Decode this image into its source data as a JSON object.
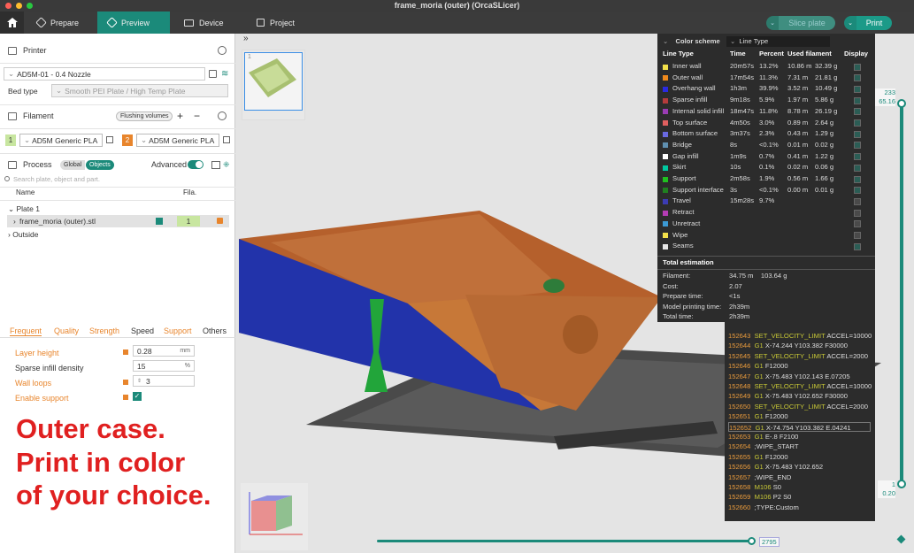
{
  "window": {
    "title": "frame_moria (outer) (OrcaSLicer)"
  },
  "toolbar": {
    "tabs": [
      {
        "label": "Prepare"
      },
      {
        "label": "Preview"
      },
      {
        "label": "Device"
      },
      {
        "label": "Project"
      }
    ],
    "slice_label": "Slice plate",
    "print_label": "Print"
  },
  "printer": {
    "section_label": "Printer",
    "name": "AD5M-01 - 0.4 Nozzle",
    "bed_type_label": "Bed type",
    "bed_type_value": "Smooth PEI Plate / High Temp Plate"
  },
  "filament": {
    "section_label": "Filament",
    "flushing_label": "Flushing volumes",
    "slots": [
      {
        "num": "1",
        "name": "AD5M Generic PLA",
        "color": "#c8e6a0"
      },
      {
        "num": "2",
        "name": "AD5M Generic PLA",
        "color": "#e8852c"
      }
    ]
  },
  "process": {
    "section_label": "Process",
    "global_label": "Global",
    "objects_label": "Objects",
    "advanced_label": "Advanced",
    "search_placeholder": "Search plate, object and part.",
    "col_name": "Name",
    "col_fila": "Fila.",
    "tree": [
      {
        "label": "Plate 1"
      },
      {
        "label": "frame_moria (outer).stl",
        "fila": "1"
      },
      {
        "label": "Outside"
      }
    ]
  },
  "settings": {
    "tabs": [
      {
        "label": "Frequent"
      },
      {
        "label": "Quality"
      },
      {
        "label": "Strength"
      },
      {
        "label": "Speed"
      },
      {
        "label": "Support"
      },
      {
        "label": "Others"
      }
    ],
    "layer_height": {
      "label": "Layer height",
      "value": "0.28",
      "unit": "mm"
    },
    "sparse_infill": {
      "label": "Sparse infill density",
      "value": "15",
      "unit": "%"
    },
    "wall_loops": {
      "label": "Wall loops",
      "value": "3"
    },
    "enable_support": {
      "label": "Enable support"
    }
  },
  "overlay_text": [
    "Outer case.",
    "Print in color",
    "of your choice."
  ],
  "legend": {
    "color_scheme_label": "Color scheme",
    "scheme_value": "Line Type",
    "headers": {
      "type": "Line Type",
      "time": "Time",
      "percent": "Percent",
      "used": "Used filament",
      "display": "Display"
    },
    "rows": [
      {
        "name": "Inner wall",
        "time": "20m57s",
        "pct": "13.2%",
        "m": "10.86 m",
        "g": "32.39 g",
        "color": "#f2e04a",
        "on": true
      },
      {
        "name": "Outer wall",
        "time": "17m54s",
        "pct": "11.3%",
        "m": "7.31 m",
        "g": "21.81 g",
        "color": "#f08a1c",
        "on": true
      },
      {
        "name": "Overhang wall",
        "time": "1h3m",
        "pct": "39.9%",
        "m": "3.52 m",
        "g": "10.49 g",
        "color": "#2a2ae0",
        "on": true
      },
      {
        "name": "Sparse infill",
        "time": "9m18s",
        "pct": "5.9%",
        "m": "1.97 m",
        "g": "5.86 g",
        "color": "#b43c3c",
        "on": true
      },
      {
        "name": "Internal solid infill",
        "time": "18m47s",
        "pct": "11.8%",
        "m": "8.78 m",
        "g": "26.19 g",
        "color": "#9a3cb4",
        "on": true
      },
      {
        "name": "Top surface",
        "time": "4m50s",
        "pct": "3.0%",
        "m": "0.89 m",
        "g": "2.64 g",
        "color": "#e06060",
        "on": true
      },
      {
        "name": "Bottom surface",
        "time": "3m37s",
        "pct": "2.3%",
        "m": "0.43 m",
        "g": "1.29 g",
        "color": "#6a6ae0",
        "on": true
      },
      {
        "name": "Bridge",
        "time": "8s",
        "pct": "<0.1%",
        "m": "0.01 m",
        "g": "0.02 g",
        "color": "#6090b0",
        "on": true
      },
      {
        "name": "Gap infill",
        "time": "1m9s",
        "pct": "0.7%",
        "m": "0.41 m",
        "g": "1.22 g",
        "color": "#ffffff",
        "on": true
      },
      {
        "name": "Skirt",
        "time": "10s",
        "pct": "0.1%",
        "m": "0.02 m",
        "g": "0.06 g",
        "color": "#00c8a0",
        "on": true
      },
      {
        "name": "Support",
        "time": "2m58s",
        "pct": "1.9%",
        "m": "0.56 m",
        "g": "1.66 g",
        "color": "#20c020",
        "on": true
      },
      {
        "name": "Support interface",
        "time": "3s",
        "pct": "<0.1%",
        "m": "0.00 m",
        "g": "0.01 g",
        "color": "#208020",
        "on": true
      },
      {
        "name": "Travel",
        "time": "15m28s",
        "pct": "9.7%",
        "m": "",
        "g": "",
        "color": "#3c3cb4",
        "on": false
      },
      {
        "name": "Retract",
        "time": "",
        "pct": "",
        "m": "",
        "g": "",
        "color": "#b43cb4",
        "on": false
      },
      {
        "name": "Unretract",
        "time": "",
        "pct": "",
        "m": "",
        "g": "",
        "color": "#3c9ad4",
        "on": false
      },
      {
        "name": "Wipe",
        "time": "",
        "pct": "",
        "m": "",
        "g": "",
        "color": "#f2e04a",
        "on": false
      },
      {
        "name": "Seams",
        "time": "",
        "pct": "",
        "m": "",
        "g": "",
        "color": "#e6e6e6",
        "on": true
      }
    ],
    "total": {
      "title": "Total estimation",
      "filament_label": "Filament:",
      "filament_m": "34.75 m",
      "filament_g": "103.64 g",
      "cost_label": "Cost:",
      "cost": "2.07",
      "prepare_label": "Prepare time:",
      "prepare": "<1s",
      "model_label": "Model printing time:",
      "model": "2h39m",
      "total_label": "Total time:",
      "total": "2h39m"
    }
  },
  "gcode": [
    {
      "n": "152643",
      "c": "SET_VELOCITY_LIMIT",
      "a": " ACCEL=10000"
    },
    {
      "n": "152644",
      "c": "G1",
      "a": " X-74.244 Y103.382 F30000"
    },
    {
      "n": "152645",
      "c": "SET_VELOCITY_LIMIT",
      "a": " ACCEL=2000"
    },
    {
      "n": "152646",
      "c": "G1",
      "a": " F12000"
    },
    {
      "n": "152647",
      "c": "G1",
      "a": " X-75.483 Y102.143 E.07205"
    },
    {
      "n": "152648",
      "c": "SET_VELOCITY_LIMIT",
      "a": " ACCEL=10000"
    },
    {
      "n": "152649",
      "c": "G1",
      "a": " X-75.483 Y102.652 F30000"
    },
    {
      "n": "152650",
      "c": "SET_VELOCITY_LIMIT",
      "a": " ACCEL=2000"
    },
    {
      "n": "152651",
      "c": "G1",
      "a": " F12000"
    },
    {
      "n": "152652",
      "c": "G1",
      "a": " X-74.754 Y103.382 E.04241"
    },
    {
      "n": "152653",
      "c": "G1",
      "a": " E-.8 F2100"
    },
    {
      "n": "152654",
      "c": "",
      "a": ";WIPE_START"
    },
    {
      "n": "152655",
      "c": "G1",
      "a": " F12000"
    },
    {
      "n": "152656",
      "c": "G1",
      "a": " X-75.483 Y102.652"
    },
    {
      "n": "152657",
      "c": "",
      "a": ";WIPE_END"
    },
    {
      "n": "152658",
      "c": "M106",
      "a": " S0"
    },
    {
      "n": "152659",
      "c": "M106",
      "a": " P2 S0"
    },
    {
      "n": "152660",
      "c": "",
      "a": ";TYPE:Custom"
    }
  ],
  "layer_slider": {
    "top_layer": "233",
    "top_height": "65.16",
    "bottom_layer": "1",
    "bottom_height": "0.20"
  },
  "move_slider": {
    "value": "2795"
  }
}
